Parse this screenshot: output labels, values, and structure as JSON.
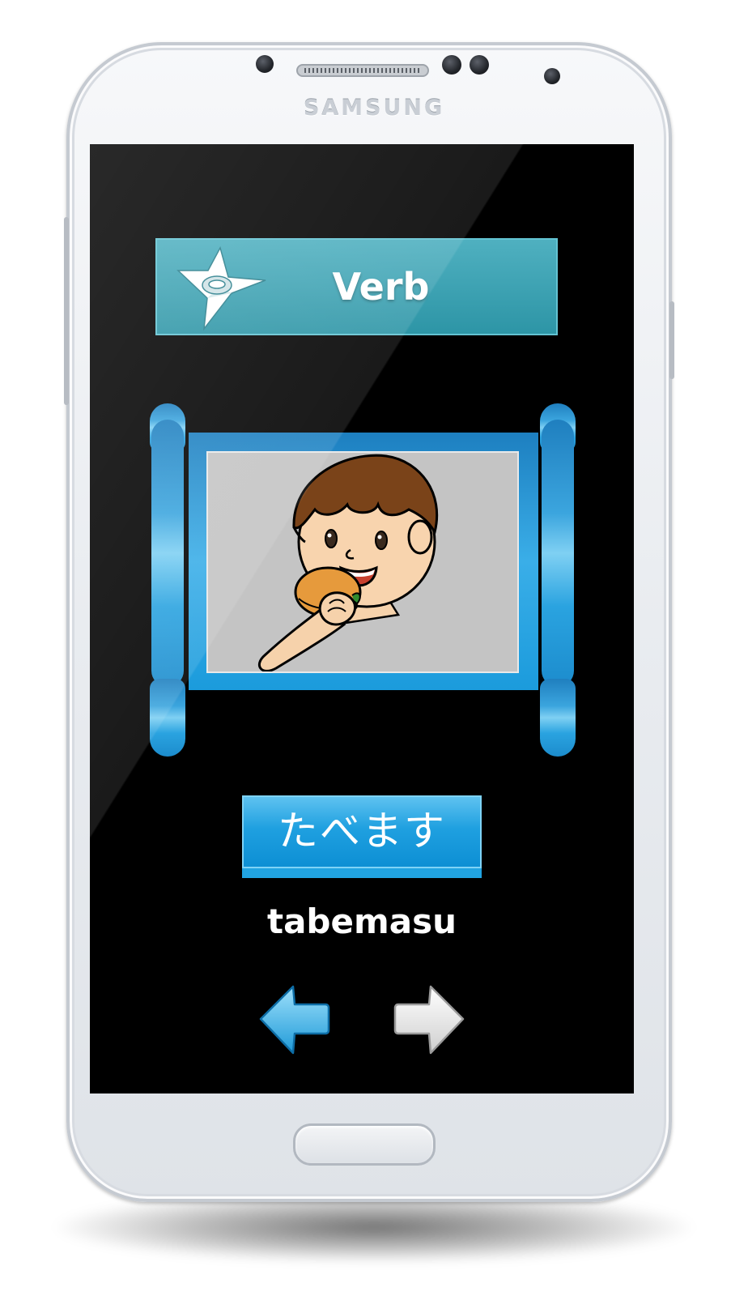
{
  "device": {
    "brand": "SAMSUNG"
  },
  "app": {
    "category": {
      "title": "Verb",
      "icon": "shuriken-icon"
    },
    "flashcard": {
      "image": "boy-eating-burger-illustration",
      "kana": "たべます",
      "romaji": "tabemasu"
    },
    "navigation": {
      "previous_icon": "arrow-left-icon",
      "next_icon": "arrow-right-icon"
    }
  },
  "colors": {
    "banner": "#2d95a6",
    "scroll_blue": "#1fa0e0",
    "screen_bg": "#000000",
    "next_arrow": "#ffffff",
    "prev_arrow": "#3fb2ea"
  }
}
